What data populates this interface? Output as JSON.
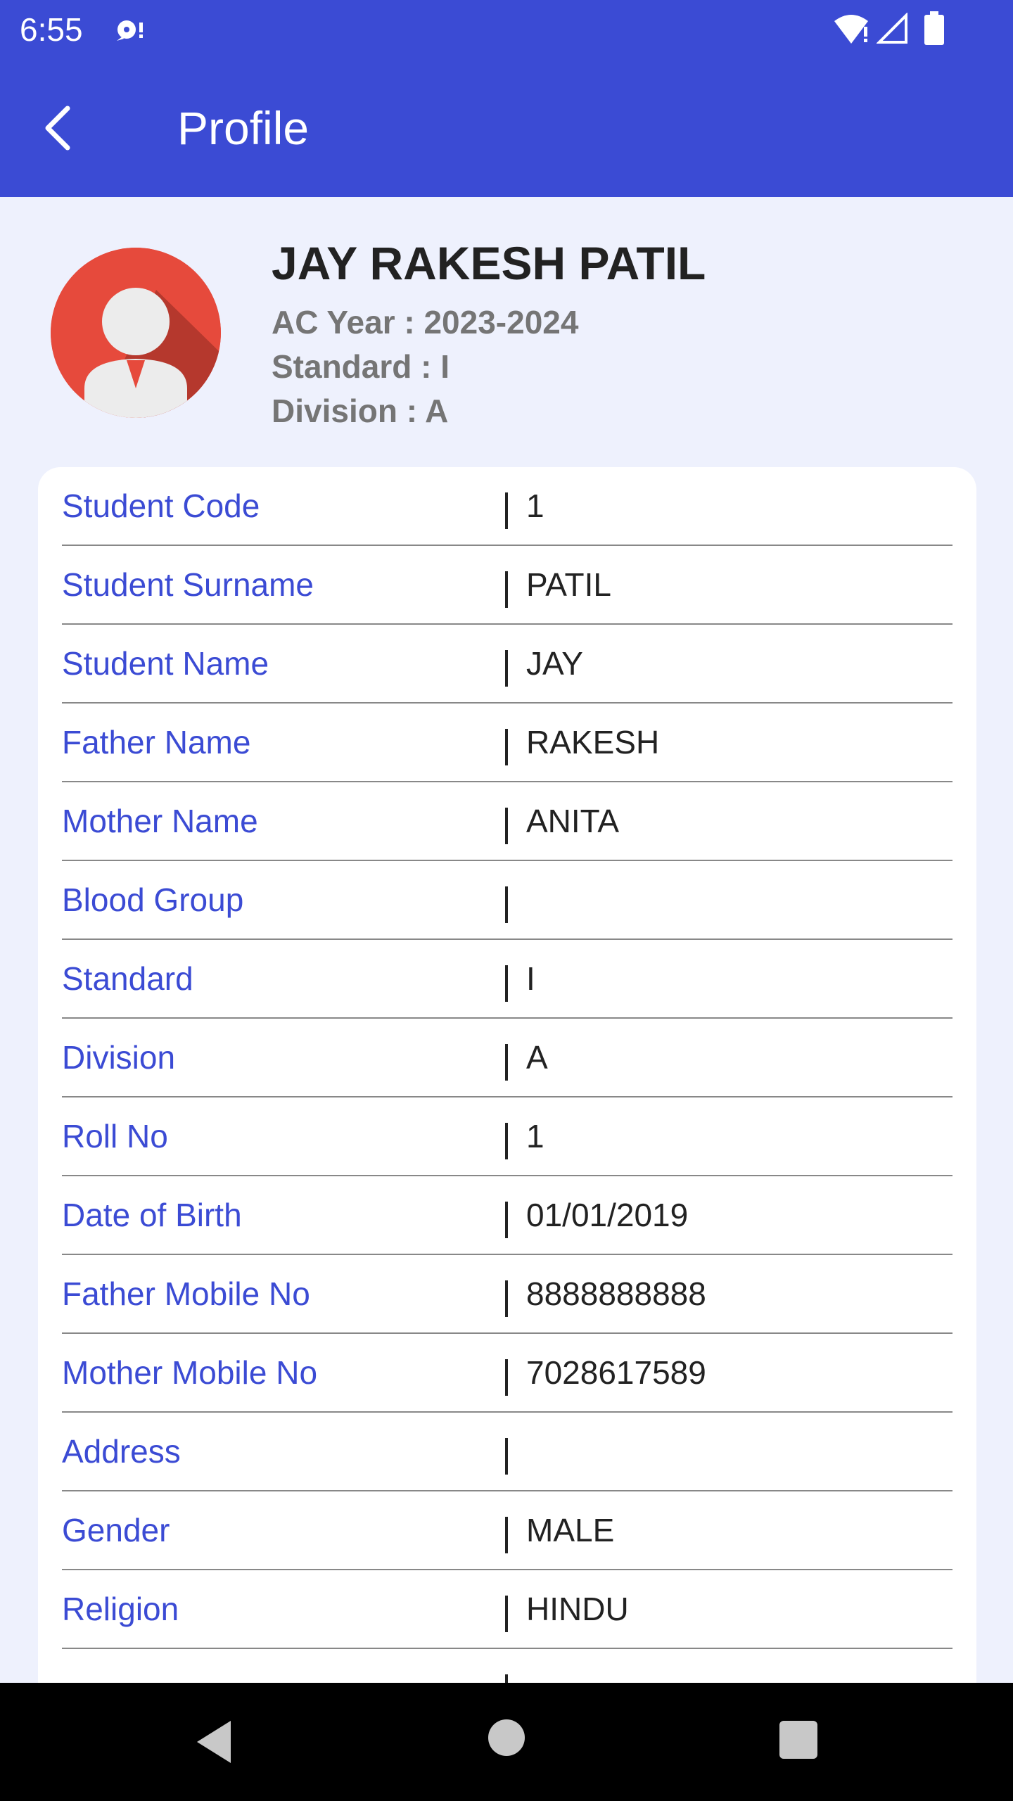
{
  "status_bar": {
    "time": "6:55",
    "icons": [
      "notification-icon",
      "wifi-icon",
      "signal-icon",
      "battery-icon"
    ]
  },
  "app_bar": {
    "title": "Profile",
    "back_icon": "back-arrow-icon",
    "background": "#3b4bd4"
  },
  "profile": {
    "name": "JAY RAKESH PATIL",
    "ac_year": "AC Year : 2023-2024",
    "standard": "Standard : I",
    "division": "Division : A",
    "avatar_icon": "user-avatar-icon"
  },
  "details": [
    {
      "label": "Student Code",
      "value": "1"
    },
    {
      "label": "Student Surname",
      "value": "PATIL"
    },
    {
      "label": "Student Name",
      "value": "JAY"
    },
    {
      "label": "Father Name",
      "value": "RAKESH"
    },
    {
      "label": "Mother Name",
      "value": "ANITA"
    },
    {
      "label": "Blood Group",
      "value": ""
    },
    {
      "label": "Standard",
      "value": "I"
    },
    {
      "label": "Division",
      "value": "A"
    },
    {
      "label": "Roll No",
      "value": "1"
    },
    {
      "label": "Date of Birth",
      "value": "01/01/2019"
    },
    {
      "label": "Father Mobile No",
      "value": "8888888888"
    },
    {
      "label": "Mother Mobile No",
      "value": "7028617589"
    },
    {
      "label": "Address",
      "value": ""
    },
    {
      "label": "Gender",
      "value": "MALE"
    },
    {
      "label": "Religion",
      "value": "HINDU"
    },
    {
      "label": "",
      "value": ""
    }
  ],
  "nav_bar": {
    "icons": [
      "nav-back-icon",
      "nav-home-icon",
      "nav-recents-icon"
    ]
  },
  "colors": {
    "accent": "#3b4bd4",
    "label": "#3b4bd4",
    "meta_text": "#757575",
    "background": "#eef1fd"
  }
}
